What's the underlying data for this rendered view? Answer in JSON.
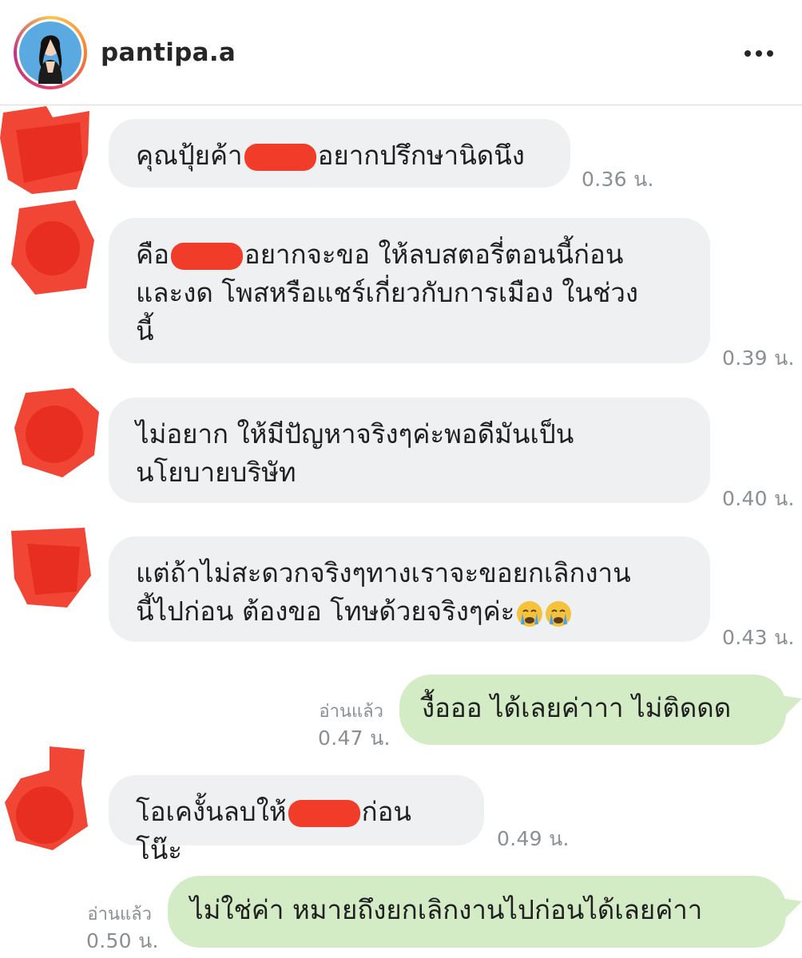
{
  "header": {
    "username": "pantipa.a",
    "more_icon": "more-horizontal-icon"
  },
  "colors": {
    "incoming_bubble": "#eef0f2",
    "outgoing_bubble": "#d3ecc6",
    "redaction": "#f0321f",
    "timestamp": "#8a8f94"
  },
  "messages": [
    {
      "dir": "in",
      "text_before": "คุณปุ้ยค้า",
      "text_after": "อยากปรึกษานิดนึง",
      "time": "0.36 น."
    },
    {
      "dir": "in",
      "text_before": "คือ",
      "text_after": "อยากจะขอ ให้ลบสตอรี่ตอนนี้ก่อน\nและงด โพสหรือแชร์เกี่ยวกับการเมือง ในช่วง\nนี้",
      "time": "0.39 น."
    },
    {
      "dir": "in",
      "text": "ไม่อยาก ให้มีปัญหาจริงๆค่ะพอดีมันเป็น\nนโยบายบริษัท",
      "time": "0.40 น."
    },
    {
      "dir": "in",
      "text": "แต่ถ้าไม่สะดวกจริงๆทางเราจะขอยกเลิกงาน\nนี้ไปก่อน ต้องขอ โทษด้วยจริงๆค่ะ",
      "emoji": "crying-face-emoji",
      "time": "0.43 น."
    },
    {
      "dir": "out",
      "text": "งื้อออ ได้เลยค่าาา ไม่ติดดด",
      "read": "อ่านแล้ว",
      "time": "0.47 น."
    },
    {
      "dir": "in",
      "text_before": "โอเคงั้นลบให้",
      "text_after": "ก่อนโน๊ะ",
      "time": "0.49 น."
    },
    {
      "dir": "out",
      "text": "ไม่ใช่ค่า หมายถึงยกเลิกงานไปก่อนได้เลยค่าา",
      "read": "อ่านแล้ว",
      "time": "0.50 น."
    }
  ]
}
